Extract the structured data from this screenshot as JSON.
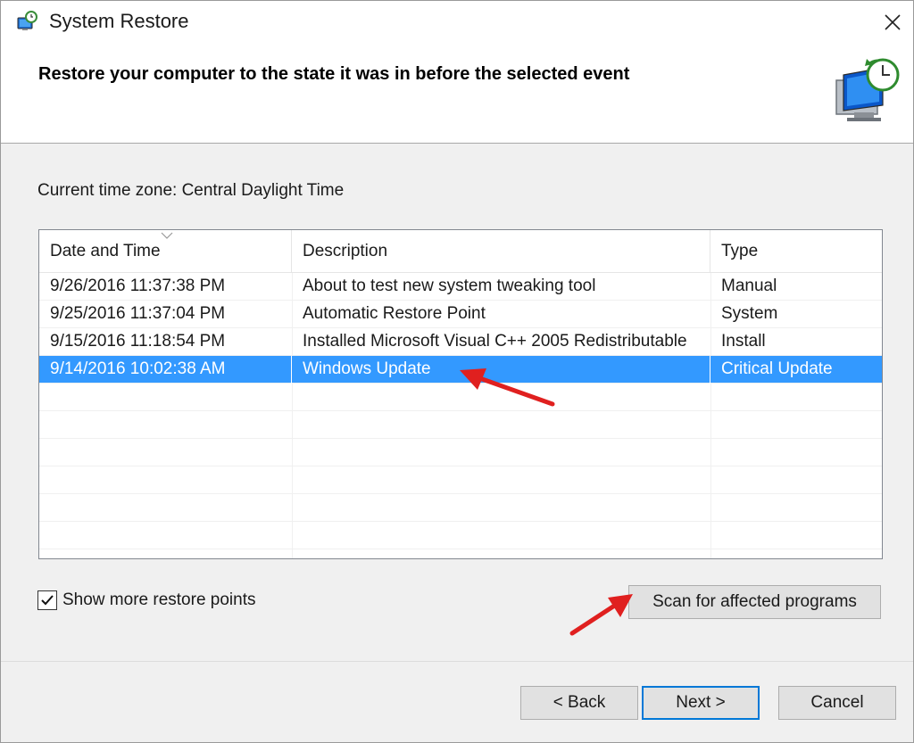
{
  "window": {
    "title": "System Restore",
    "close_glyph": "✕"
  },
  "header": {
    "title": "Restore your computer to the state it was in before the selected event"
  },
  "timezone": "Current time zone: Central Daylight Time",
  "table": {
    "columns": [
      "Date and Time",
      "Description",
      "Type"
    ],
    "rows": [
      {
        "date": "9/26/2016 11:37:38 PM",
        "description": "About to test new system tweaking tool",
        "type": "Manual",
        "selected": false
      },
      {
        "date": "9/25/2016 11:37:04 PM",
        "description": "Automatic Restore Point",
        "type": "System",
        "selected": false
      },
      {
        "date": "9/15/2016 11:18:54 PM",
        "description": "Installed Microsoft Visual C++ 2005 Redistributable",
        "type": "Install",
        "selected": false
      },
      {
        "date": "9/14/2016 10:02:38 AM",
        "description": "Windows Update",
        "type": "Critical Update",
        "selected": true
      }
    ],
    "sorted_column": "Date and Time"
  },
  "show_more": {
    "label": "Show more restore points",
    "checked": true
  },
  "buttons": {
    "scan": "Scan for affected programs",
    "back": "< Back",
    "next": "Next >",
    "cancel": "Cancel"
  },
  "colors": {
    "selection": "#3399ff",
    "annotation_arrow": "#e0201f",
    "default_button_border": "#0078d7"
  },
  "icons": {
    "title": "system-restore-icon",
    "header": "restore-computer-clock-icon",
    "close": "close-icon"
  }
}
